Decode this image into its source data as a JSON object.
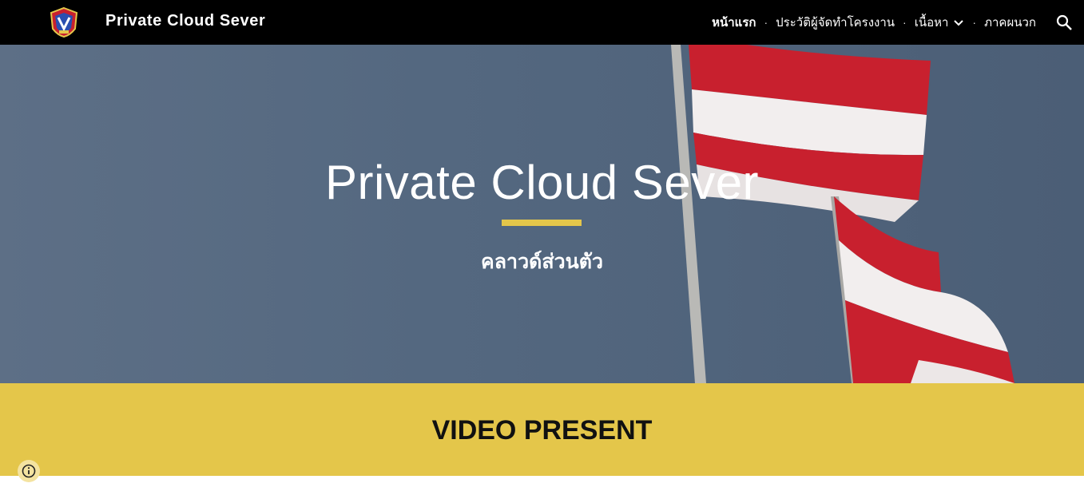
{
  "header": {
    "site_title": "Private Cloud Sever",
    "logo_icon": "school-crest-logo",
    "nav": [
      {
        "label": "หน้าแรก",
        "active": true
      },
      {
        "label": "ประวัติผู้จัดทำโครงงาน",
        "active": false
      },
      {
        "label": "เนื้อหา",
        "active": false,
        "has_dropdown": true
      },
      {
        "label": "ภาคผนวก",
        "active": false
      }
    ],
    "separator": "·",
    "search_icon": "search-icon"
  },
  "hero": {
    "title": "Private Cloud Sever",
    "subtitle": "คลาวด์ส่วนตัว"
  },
  "section": {
    "title": "VIDEO PRESENT"
  },
  "footer": {
    "info_icon": "info-icon"
  },
  "colors": {
    "topbar": "#000000",
    "accent": "#e4c64a",
    "hero_sky": "#546880",
    "flag_red": "#c8202e",
    "flag_white": "#f2eeee"
  }
}
